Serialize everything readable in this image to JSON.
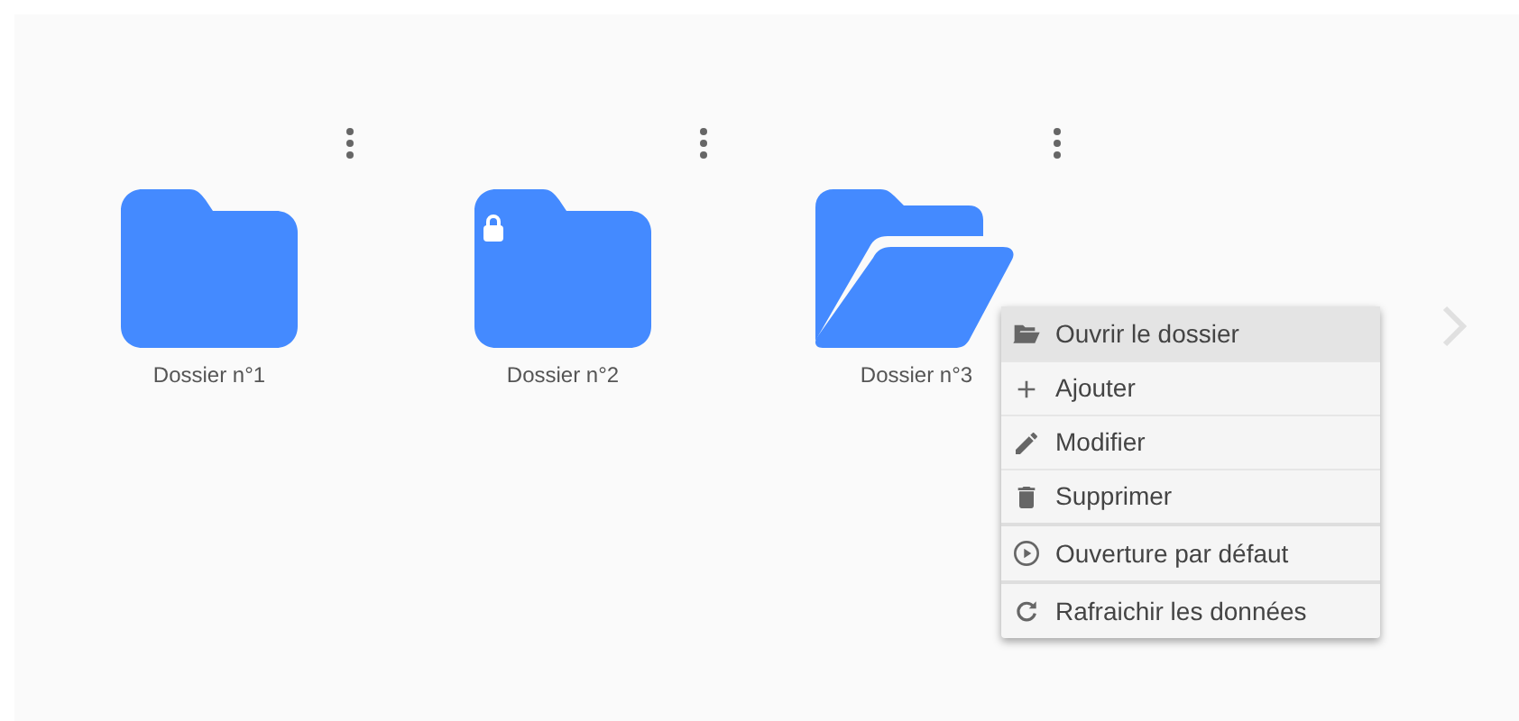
{
  "folders": [
    {
      "label": "Dossier n°1",
      "locked": false,
      "open": false
    },
    {
      "label": "Dossier n°2",
      "locked": true,
      "open": false
    },
    {
      "label": "Dossier n°3",
      "locked": false,
      "open": true
    }
  ],
  "context_menu": {
    "groups": [
      [
        {
          "label": "Ouvrir le dossier",
          "kind": "open",
          "selected": true
        },
        {
          "label": "Ajouter",
          "kind": "add",
          "selected": false
        },
        {
          "label": "Modifier",
          "kind": "edit",
          "selected": false
        },
        {
          "label": "Supprimer",
          "kind": "delete",
          "selected": false
        }
      ],
      [
        {
          "label": "Ouverture par défaut",
          "kind": "play",
          "selected": false
        }
      ],
      [
        {
          "label": "Rafraichir les données",
          "kind": "refresh",
          "selected": false
        }
      ]
    ]
  }
}
